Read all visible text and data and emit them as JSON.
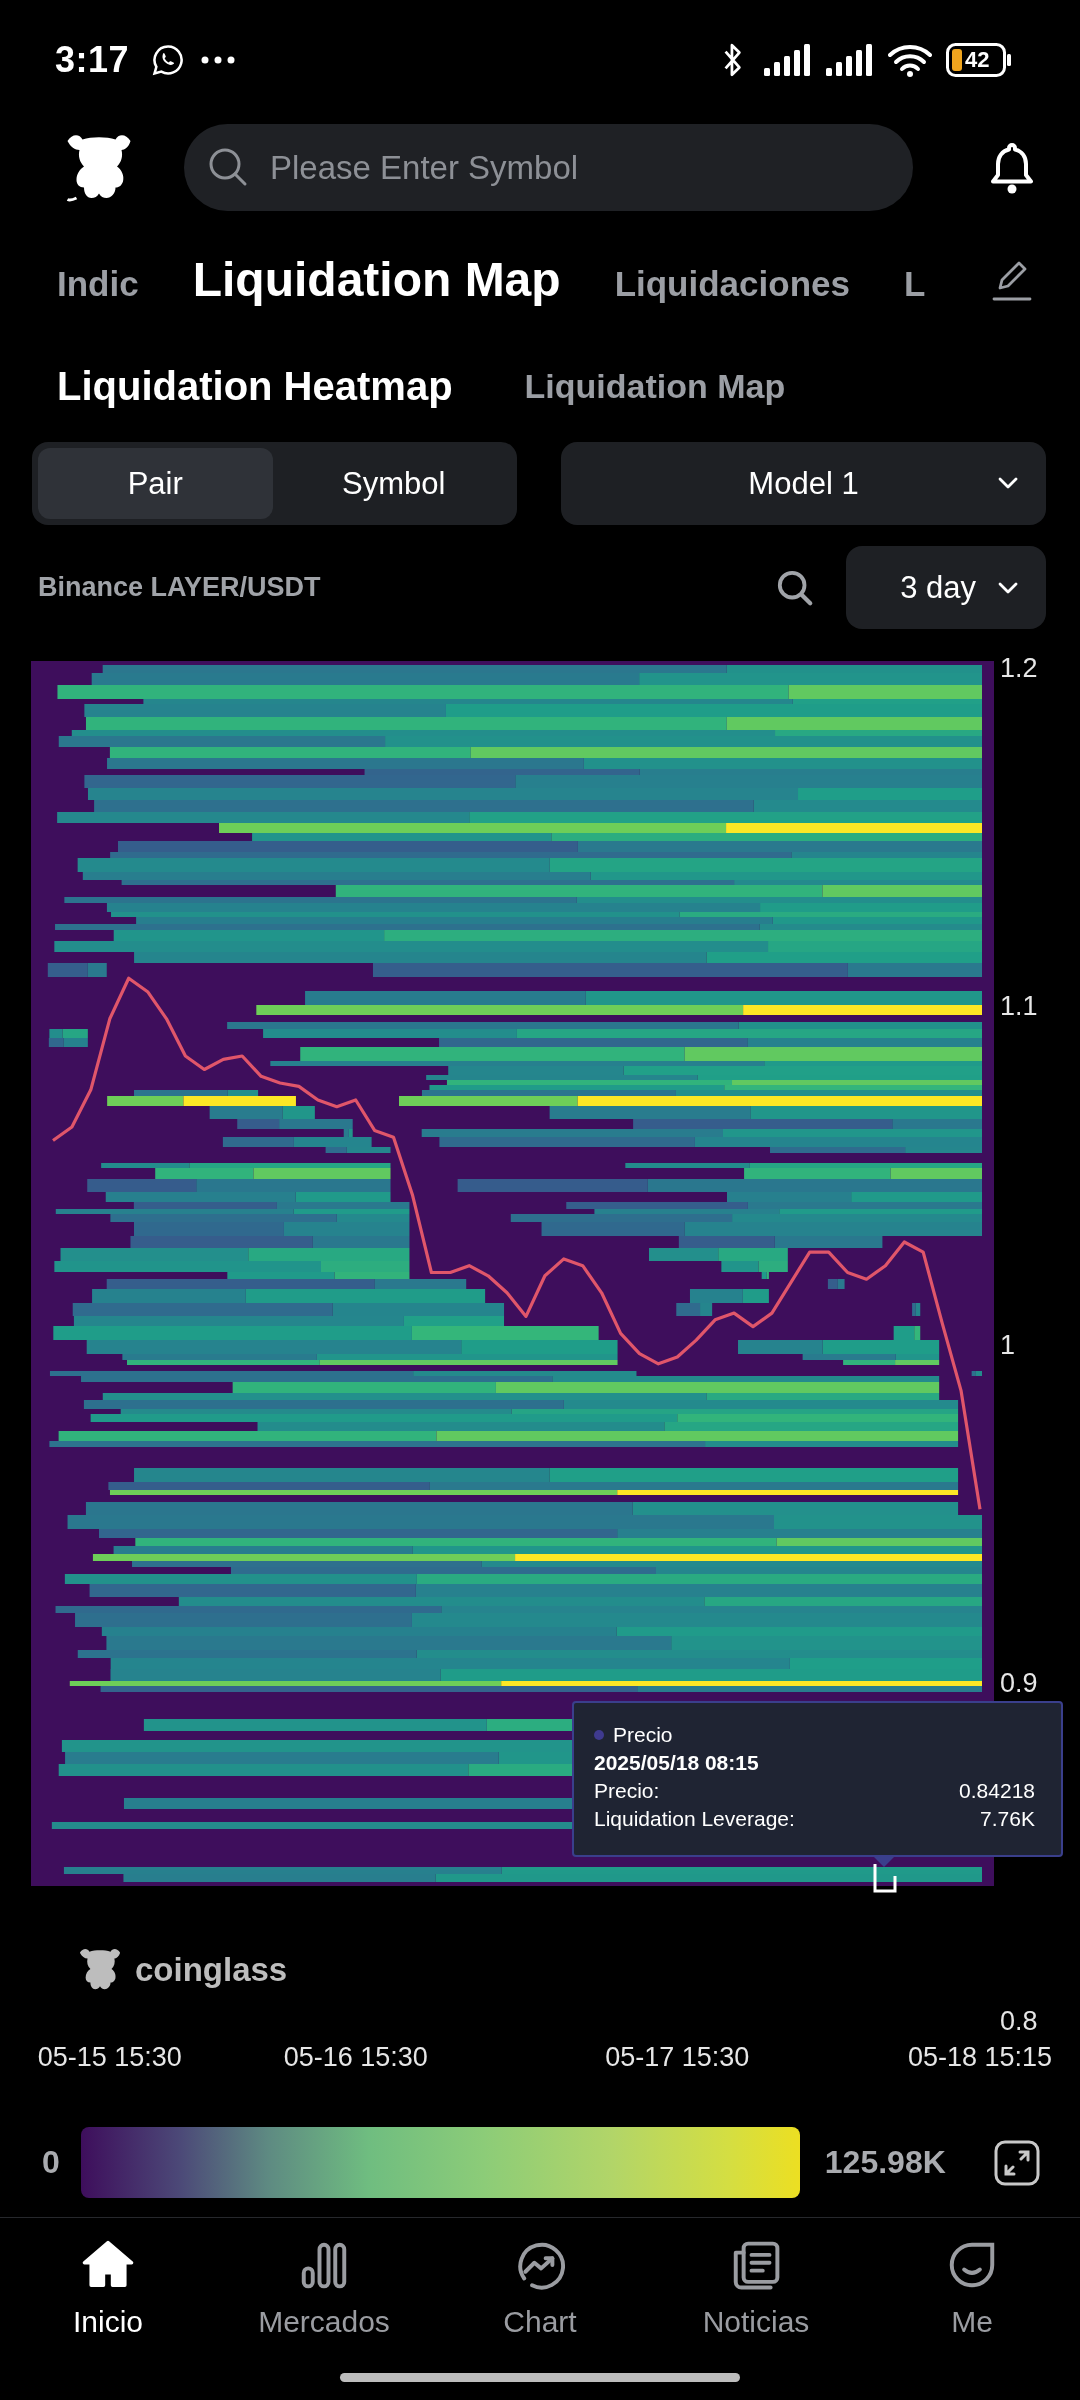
{
  "status_bar": {
    "time": "3:17",
    "battery": "42"
  },
  "header": {
    "search": {
      "placeholder": "Please Enter Symbol"
    }
  },
  "tabs": [
    {
      "label": "Indic",
      "selected": false
    },
    {
      "label": "Liquidation Map",
      "selected": true
    },
    {
      "label": "Liquidaciones",
      "selected": false
    },
    {
      "label": "L",
      "selected": false
    }
  ],
  "sub_tabs": [
    {
      "label": "Liquidation Heatmap",
      "selected": true
    },
    {
      "label": "Liquidation Map",
      "selected": false
    }
  ],
  "mode_toggle": [
    {
      "label": "Pair",
      "selected": true
    },
    {
      "label": "Symbol",
      "selected": false
    }
  ],
  "model_dropdown": {
    "value": "Model 1"
  },
  "pair": "Binance LAYER/USDT",
  "period_dropdown": {
    "value": "3 day"
  },
  "heatmap": {
    "chart_data": {
      "type": "line",
      "categories": [
        null,
        null,
        null,
        "05-15 15:30",
        null,
        null,
        null,
        null,
        null,
        null,
        null,
        null,
        null,
        null,
        null,
        null,
        "05-16 15:30",
        null,
        null,
        null,
        null,
        null,
        null,
        null,
        null,
        null,
        null,
        null,
        null,
        null,
        null,
        null,
        null,
        "05-17 15:30",
        null,
        null,
        null,
        null,
        null,
        null,
        null,
        null,
        null,
        null,
        null,
        null,
        null,
        null,
        null,
        "05-18 15:15"
      ],
      "series": [
        {
          "name": "Precio",
          "color": "#e0566a",
          "values": [
            1.06,
            1.064,
            1.075,
            1.096,
            1.108,
            1.104,
            1.096,
            1.085,
            1.081,
            1.084,
            1.085,
            1.079,
            1.077,
            1.076,
            1.072,
            1.07,
            1.072,
            1.063,
            1.061,
            1.044,
            1.021,
            1.021,
            1.023,
            1.02,
            1.015,
            1.008,
            1.02,
            1.025,
            1.023,
            1.015,
            1.003,
            0.997,
            0.994,
            0.996,
            1.001,
            1.007,
            1.009,
            1.005,
            1.009,
            1.018,
            1.027,
            1.027,
            1.021,
            1.019,
            1.023,
            1.03,
            1.027,
            1.006,
            0.986,
            0.951
          ]
        }
      ],
      "ylim": [
        0.8,
        1.2
      ],
      "yticks": [
        1.2,
        1.1,
        1,
        0.9,
        0.8
      ]
    },
    "watermark": "coinglass",
    "tooltip": {
      "time": "2025/05/18 08:15",
      "rows": [
        {
          "label": "Precio:",
          "value": "0.84218"
        },
        {
          "label": "Liquidation Leverage:",
          "value": "7.76K"
        }
      ]
    }
  },
  "color_scale": {
    "min": "0",
    "max": "125.98K"
  },
  "bottom_nav": [
    {
      "label": "Inicio",
      "selected": true
    },
    {
      "label": "Mercados",
      "selected": false
    },
    {
      "label": "Chart",
      "selected": false
    },
    {
      "label": "Noticias",
      "selected": false
    },
    {
      "label": "Me",
      "selected": false
    }
  ]
}
